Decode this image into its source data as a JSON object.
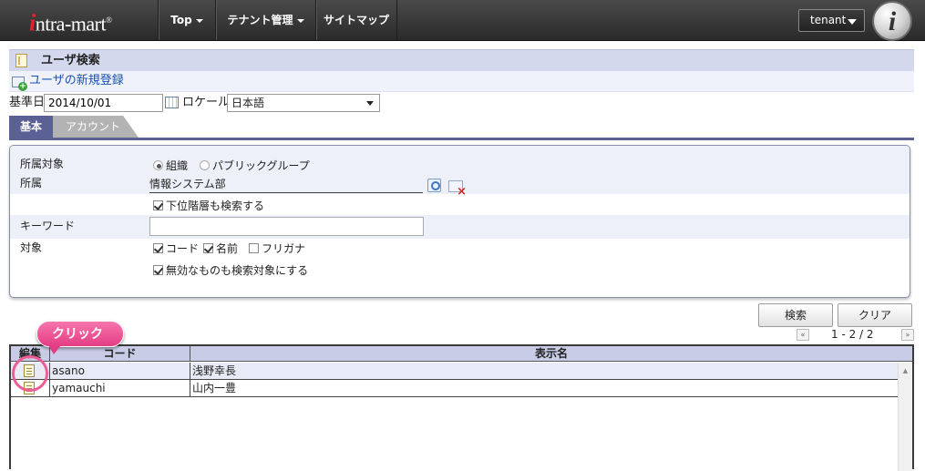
{
  "header": {
    "logo": {
      "mark": "i",
      "text": "ntra-mart",
      "reg": "®"
    },
    "nav": [
      {
        "label": "Top",
        "dropdown": true
      },
      {
        "label": "テナント管理",
        "dropdown": true
      },
      {
        "label": "サイトマップ",
        "dropdown": false
      }
    ],
    "tenant_label": "tenant",
    "avatar_letter": "i"
  },
  "page": {
    "title": "ユーザ検索",
    "new_user_link": "ユーザの新規登録"
  },
  "filters": {
    "base_date_label": "基準日",
    "base_date_value": "2014/10/01",
    "locale_label": "ロケール",
    "locale_value": "日本語"
  },
  "tabs": [
    {
      "label": "基本",
      "active": true
    },
    {
      "label": "アカウント",
      "active": false
    }
  ],
  "form": {
    "affiliation_target": {
      "label": "所属対象",
      "options": [
        {
          "label": "組織",
          "checked": true
        },
        {
          "label": "パブリックグループ",
          "checked": false
        }
      ]
    },
    "affiliation": {
      "label": "所属",
      "value": "情報システム部",
      "include_sub": {
        "label": "下位階層も検索する",
        "checked": true
      }
    },
    "keyword": {
      "label": "キーワード",
      "value": ""
    },
    "target": {
      "label": "対象",
      "options": [
        {
          "label": "コード",
          "checked": true
        },
        {
          "label": "名前",
          "checked": true
        },
        {
          "label": "フリガナ",
          "checked": false
        }
      ],
      "include_invalid": {
        "label": "無効なものも検索対象にする",
        "checked": true
      }
    }
  },
  "buttons": {
    "search": "検索",
    "clear": "クリア"
  },
  "paging": {
    "first": "«",
    "last": "»",
    "info": "1 - 2 / 2"
  },
  "grid": {
    "columns": [
      "編集",
      "コード",
      "表示名"
    ],
    "rows": [
      {
        "code": "asano",
        "name": "浅野幸長"
      },
      {
        "code": "yamauchi",
        "name": "山内一豊"
      }
    ]
  },
  "callout": {
    "label": "クリック"
  },
  "colors": {
    "topbar": "#333333",
    "title_bar": "#d3d8ec",
    "tab_active": "#5b6195",
    "tab_inactive": "#b3b3b3",
    "grid_header": "#c8cce6",
    "callout": "#ee5d96",
    "link": "#1a4fb5"
  },
  "icons": [
    "calendar-icon",
    "search-icon",
    "clear-icon",
    "edit-icon",
    "new-user-icon",
    "page-icon"
  ]
}
